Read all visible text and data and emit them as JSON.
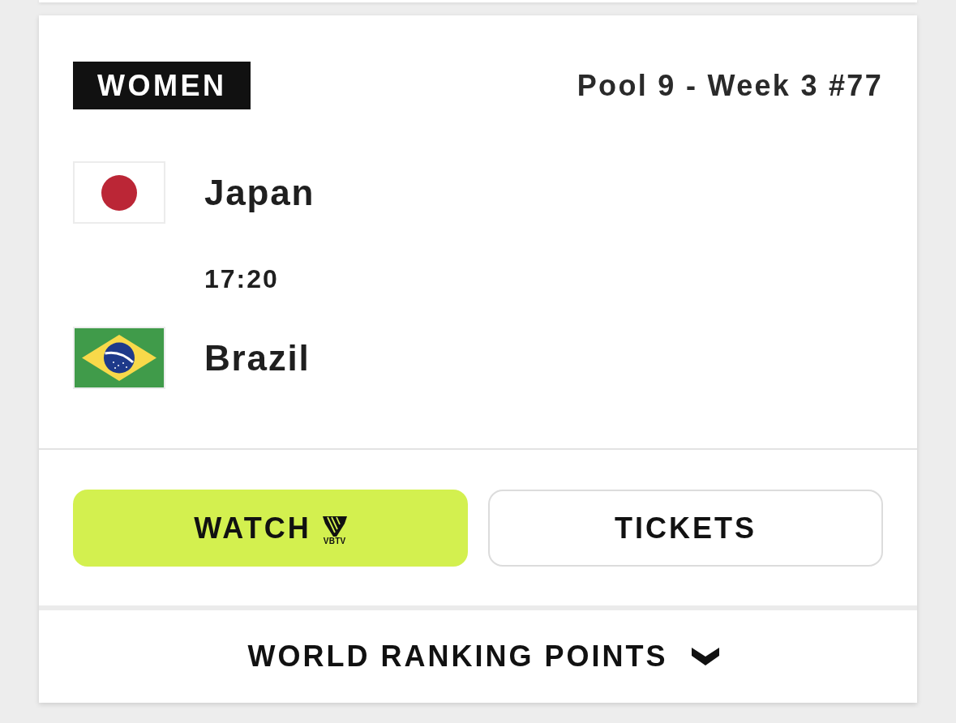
{
  "card": {
    "category": "WOMEN",
    "match_label": "Pool 9 - Week 3 #77",
    "teams": [
      {
        "name": "Japan"
      },
      {
        "name": "Brazil"
      }
    ],
    "time": "17:20",
    "buttons": [
      {
        "kind": "watch",
        "label": "WATCH",
        "logo_text": "VBTV"
      },
      {
        "kind": "tickets",
        "label": "TICKETS"
      }
    ],
    "footer": {
      "label": "WORLD RANKING POINTS",
      "expanded": false
    }
  }
}
